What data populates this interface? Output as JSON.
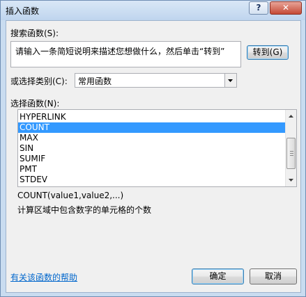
{
  "window": {
    "title": "插入函数",
    "help_button": "?",
    "close_button": "✕"
  },
  "search": {
    "label": "搜索函数(S):",
    "text": "请输入一条简短说明来描述您想做什么，然后单击“转到”",
    "go_button": "转到(G)"
  },
  "category": {
    "label": "或选择类别(C):",
    "selected": "常用函数"
  },
  "functions": {
    "label": "选择函数(N):",
    "items": [
      "HYPERLINK",
      "COUNT",
      "MAX",
      "SIN",
      "SUMIF",
      "PMT",
      "STDEV"
    ],
    "selected_index": 1
  },
  "description": {
    "signature": "COUNT(value1,value2,...)",
    "text": "计算区域中包含数字的单元格的个数"
  },
  "footer": {
    "help_link": "有关该函数的帮助",
    "ok_button": "确定",
    "cancel_button": "取消"
  },
  "icons": {
    "combo_arrow": "dropdown-arrow-icon",
    "scroll_up": "scroll-up-arrow-icon",
    "scroll_down": "scroll-down-arrow-icon"
  }
}
